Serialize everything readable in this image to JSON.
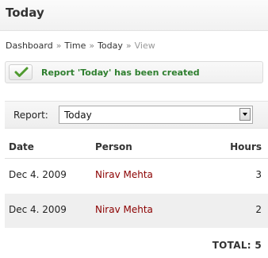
{
  "page": {
    "title": "Today"
  },
  "breadcrumb": {
    "items": [
      "Dashboard",
      "Time",
      "Today",
      "View"
    ],
    "separator": "»"
  },
  "notice": {
    "icon": "checkmark-icon",
    "message": "Report 'Today' has been created",
    "color": "#2f7f2f"
  },
  "report_selector": {
    "label": "Report:",
    "selected": "Today"
  },
  "table": {
    "columns": [
      "Date",
      "Person",
      "Hours"
    ],
    "rows": [
      {
        "date": "Dec 4. 2009",
        "person": "Nirav Mehta",
        "hours": "3"
      },
      {
        "date": "Dec 4. 2009",
        "person": "Nirav Mehta",
        "hours": "2"
      }
    ],
    "total_label": "TOTAL: 5"
  }
}
